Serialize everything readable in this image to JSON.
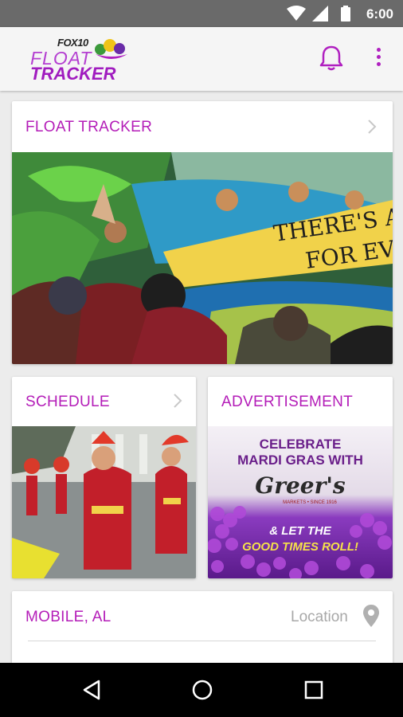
{
  "status": {
    "time": "6:00"
  },
  "app": {
    "logo_top": "FOX10",
    "logo_line1": "FLOAT",
    "logo_line2": "TRACKER"
  },
  "cards": {
    "float_tracker": {
      "title": "FLOAT TRACKER",
      "banner_line1": "THERE'S A",
      "banner_line2": "FOR EV"
    },
    "schedule": {
      "title": "SCHEDULE"
    },
    "advertisement": {
      "title": "ADVERTISEMENT",
      "ad_line1": "CELEBRATE",
      "ad_line2": "MARDI GRAS WITH",
      "brand": "Greer's",
      "brand_tag": "MARKETS • SINCE 1916",
      "ad_line3": "& LET THE",
      "ad_line4": "GOOD TIMES ROLL!"
    },
    "location": {
      "city": "MOBILE, AL",
      "label": "Location"
    }
  },
  "colors": {
    "accent": "#b41db8",
    "status_bar": "#6a6a6a",
    "background": "#ececec"
  }
}
